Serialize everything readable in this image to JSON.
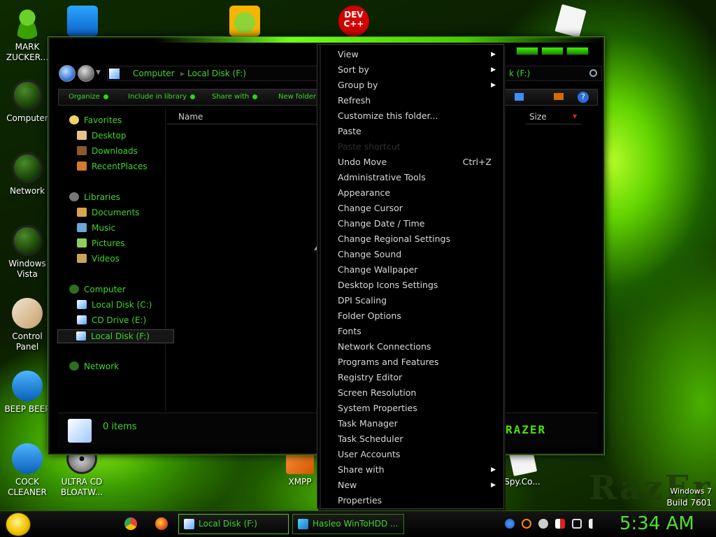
{
  "desktop": {
    "icons": [
      {
        "label": "MARK ZUCKER...",
        "icon": "person-icon"
      },
      {
        "label": "Computer",
        "icon": "computer-icon"
      },
      {
        "label": "Network",
        "icon": "network-icon"
      },
      {
        "label": "Windows Vista",
        "icon": "recycle-bin-icon"
      },
      {
        "label": "Control Panel",
        "icon": "control-panel-icon"
      },
      {
        "label": "BEEP BEEP",
        "icon": "blue-file-icon"
      },
      {
        "label": "COCK CLEANER",
        "icon": "blue-file-icon"
      },
      {
        "label": "ULTRA CD BLOATW...",
        "icon": "disc-icon"
      },
      {
        "label": "XMPP",
        "icon": "xampp-icon"
      },
      {
        "label": "Spy.Co...",
        "icon": "document-icon"
      }
    ],
    "top_icons": [
      {
        "icon": "windows-store-icon"
      },
      {
        "icon": "angry-birds-icon"
      },
      {
        "icon": "devcpp-icon",
        "text_lines": [
          "DEV",
          "C++"
        ]
      },
      {
        "icon": "paper-icon"
      }
    ],
    "os_info": {
      "line1": "Windows 7",
      "line2": "Build 7601"
    },
    "wallpaper_brand": "RazEr"
  },
  "explorer": {
    "breadcrumb": [
      "Computer",
      "Local Disk (F:)"
    ],
    "search_text": "k (F:)",
    "toolbar": [
      "Organize",
      "Include in library",
      "Share with",
      "New folder"
    ],
    "nav": {
      "favorites": {
        "label": "Favorites",
        "items": [
          "Desktop",
          "Downloads",
          "RecentPlaces"
        ]
      },
      "libraries": {
        "label": "Libraries",
        "items": [
          "Documents",
          "Music",
          "Pictures",
          "Videos"
        ]
      },
      "computer": {
        "label": "Computer",
        "items": [
          "Local Disk (C:)",
          "CD Drive (E:)",
          "Local Disk (F:)"
        ]
      },
      "network": {
        "label": "Network"
      }
    },
    "columns": {
      "name": "Name",
      "size": "Size"
    },
    "details": {
      "items_text": "0 items"
    },
    "brand": "RAZER"
  },
  "context_menu": {
    "items": [
      {
        "label": "View",
        "submenu": true
      },
      {
        "label": "Sort by",
        "submenu": true
      },
      {
        "label": "Group by",
        "submenu": true
      },
      {
        "label": "Refresh"
      },
      {
        "label": "Customize this folder..."
      },
      {
        "label": "Paste"
      },
      {
        "label": "Paste shortcut",
        "disabled": true
      },
      {
        "label": "Undo Move",
        "shortcut": "Ctrl+Z"
      },
      {
        "label": "Administrative Tools"
      },
      {
        "label": "Appearance"
      },
      {
        "label": "Change Cursor"
      },
      {
        "label": "Change Date / Time"
      },
      {
        "label": "Change Regional Settings"
      },
      {
        "label": "Change Sound"
      },
      {
        "label": "Change Wallpaper"
      },
      {
        "label": "Desktop Icons Settings"
      },
      {
        "label": "DPI Scaling"
      },
      {
        "label": "Folder Options"
      },
      {
        "label": "Fonts"
      },
      {
        "label": "Network Connections"
      },
      {
        "label": "Programs and Features"
      },
      {
        "label": "Registry Editor"
      },
      {
        "label": "Screen Resolution"
      },
      {
        "label": "System Properties"
      },
      {
        "label": "Task Manager"
      },
      {
        "label": "Task Scheduler"
      },
      {
        "label": "User Accounts"
      },
      {
        "label": "Share with",
        "submenu": true
      },
      {
        "label": "New",
        "submenu": true
      },
      {
        "label": "Properties"
      }
    ]
  },
  "taskbar": {
    "pinned": [
      "chrome-icon",
      "firefox-icon"
    ],
    "tasks": [
      {
        "label": "Local Disk (F:)",
        "active": true
      },
      {
        "label": "Hasleo WinToHDD ..."
      }
    ],
    "tray": [
      "network-globe-icon",
      "search-icon",
      "minus-icon",
      "flag-icon",
      "monitor-icon",
      "volume-icon"
    ],
    "clock": "5:34 AM"
  },
  "colors": {
    "accent": "#3fd42b",
    "menu_bg": "#000000",
    "menu_text": "#d8d8d8"
  }
}
